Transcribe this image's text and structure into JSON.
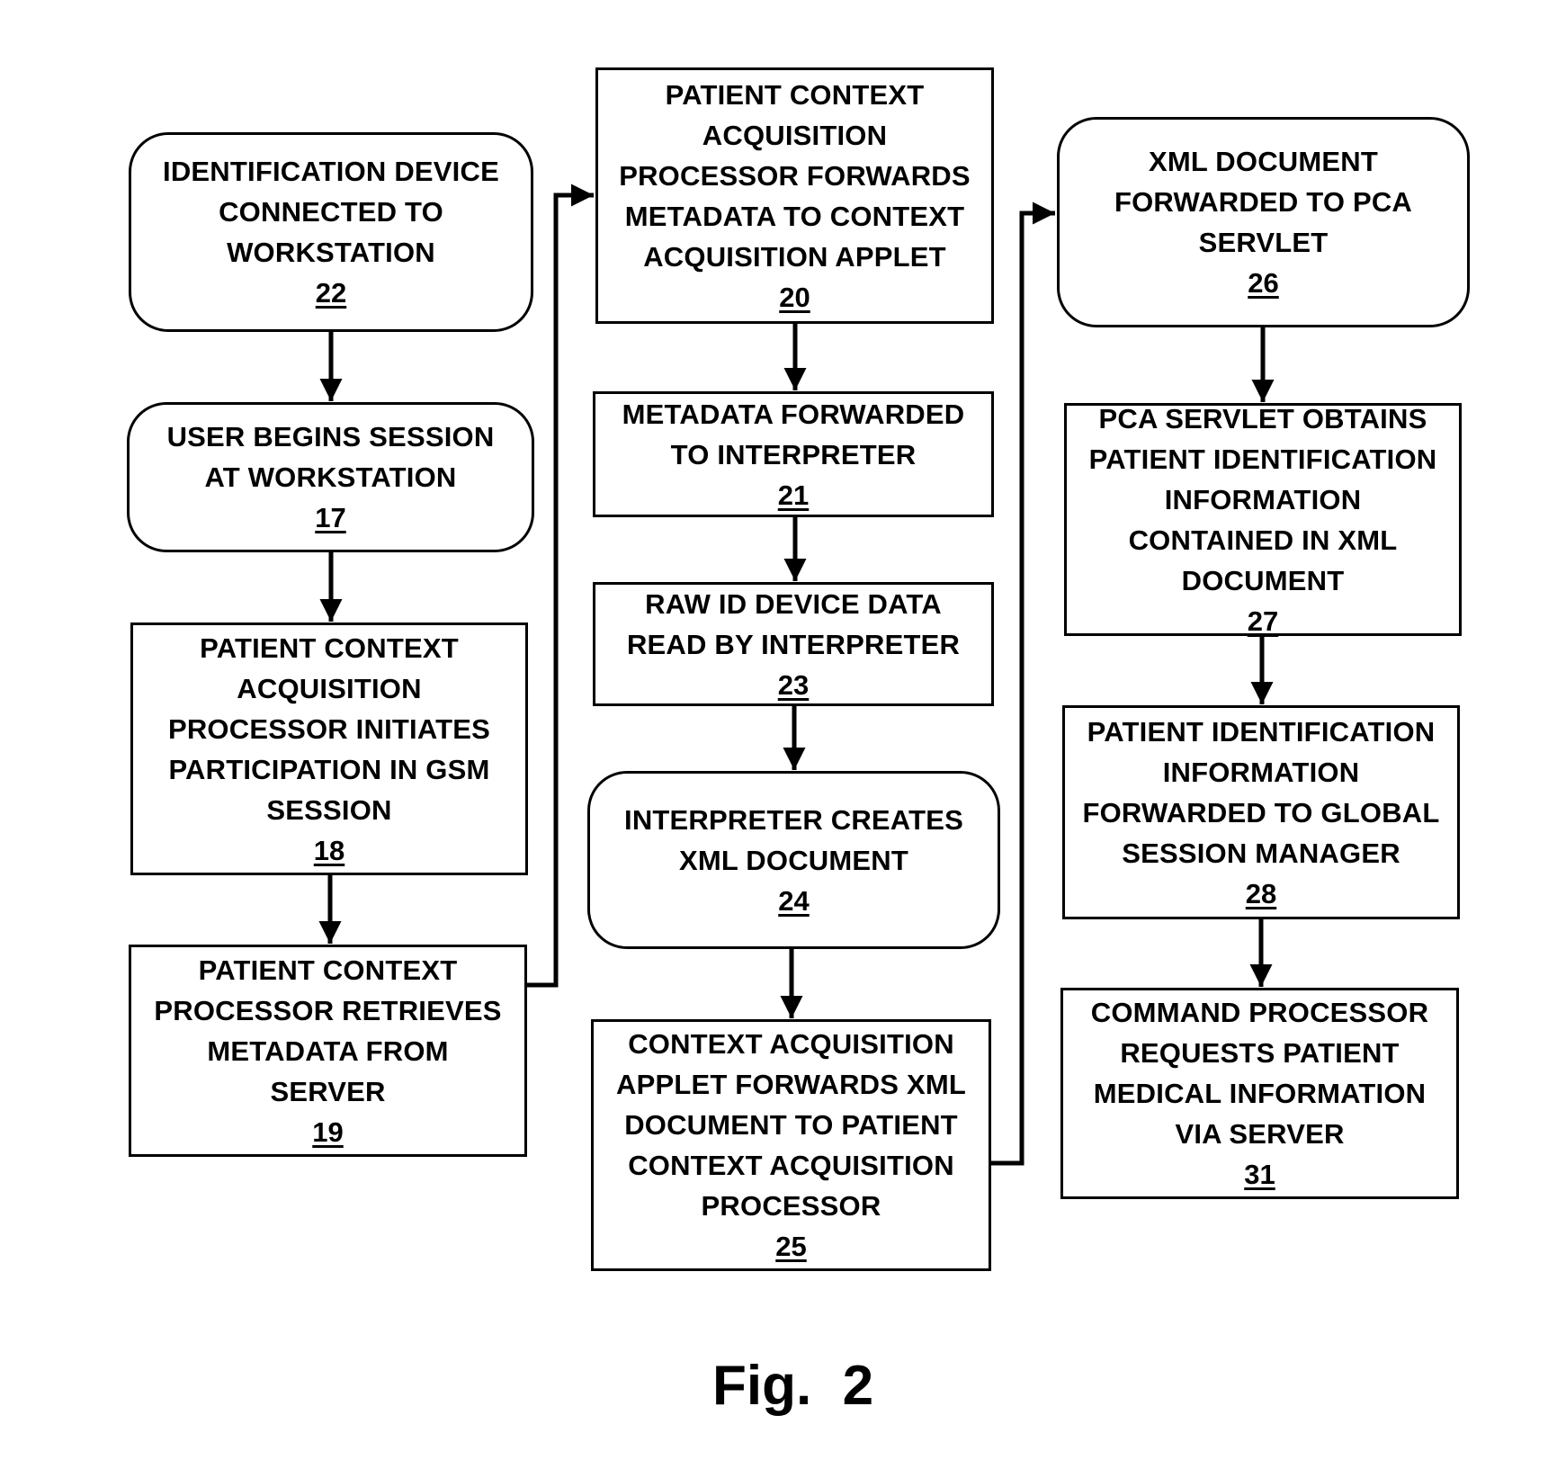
{
  "figure": {
    "label": "Fig.  2"
  },
  "steps": {
    "s22": {
      "lines": [
        "IDENTIFICATION DEVICE",
        "CONNECTED TO",
        "WORKSTATION"
      ],
      "ref": "22",
      "shape": "rounded"
    },
    "s17": {
      "lines": [
        "USER BEGINS SESSION",
        "AT WORKSTATION"
      ],
      "ref": "17",
      "shape": "rounded"
    },
    "s18": {
      "lines": [
        "PATIENT CONTEXT",
        "ACQUISITION",
        "PROCESSOR INITIATES",
        "PARTICIPATION IN GSM",
        "SESSION"
      ],
      "ref": "18",
      "shape": "rectangle"
    },
    "s19": {
      "lines": [
        "PATIENT CONTEXT",
        "PROCESSOR RETRIEVES",
        "METADATA FROM",
        "SERVER"
      ],
      "ref": "19",
      "shape": "rectangle"
    },
    "s20": {
      "lines": [
        "PATIENT CONTEXT",
        "ACQUISITION",
        "PROCESSOR FORWARDS",
        "METADATA TO CONTEXT",
        "ACQUISITION APPLET"
      ],
      "ref": "20",
      "shape": "rectangle"
    },
    "s21": {
      "lines": [
        "METADATA FORWARDED",
        "TO INTERPRETER"
      ],
      "ref": "21",
      "shape": "rectangle"
    },
    "s23": {
      "lines": [
        "RAW ID DEVICE DATA",
        "READ BY INTERPRETER"
      ],
      "ref": "23",
      "shape": "rectangle"
    },
    "s24": {
      "lines": [
        "INTERPRETER CREATES",
        "XML DOCUMENT"
      ],
      "ref": "24",
      "shape": "rounded"
    },
    "s25": {
      "lines": [
        "CONTEXT ACQUISITION",
        "APPLET FORWARDS XML",
        "DOCUMENT TO PATIENT",
        "CONTEXT ACQUISITION",
        "PROCESSOR"
      ],
      "ref": "25",
      "shape": "rectangle"
    },
    "s26": {
      "lines": [
        "XML DOCUMENT",
        "FORWARDED TO PCA",
        "SERVLET"
      ],
      "ref": "26",
      "shape": "rounded"
    },
    "s27": {
      "lines": [
        "PCA SERVLET OBTAINS",
        "PATIENT IDENTIFICATION",
        "INFORMATION",
        "CONTAINED IN XML",
        "DOCUMENT"
      ],
      "ref": "27",
      "shape": "rectangle"
    },
    "s28": {
      "lines": [
        "PATIENT IDENTIFICATION",
        "INFORMATION",
        "FORWARDED TO GLOBAL",
        "SESSION MANAGER"
      ],
      "ref": "28",
      "shape": "rectangle"
    },
    "s31": {
      "lines": [
        "COMMAND PROCESSOR",
        "REQUESTS PATIENT",
        "MEDICAL INFORMATION",
        "VIA SERVER"
      ],
      "ref": "31",
      "shape": "rectangle"
    }
  },
  "flow": [
    [
      "22",
      "17"
    ],
    [
      "17",
      "18"
    ],
    [
      "18",
      "19"
    ],
    [
      "19",
      "20"
    ],
    [
      "20",
      "21"
    ],
    [
      "21",
      "23"
    ],
    [
      "23",
      "24"
    ],
    [
      "24",
      "25"
    ],
    [
      "25",
      "26"
    ],
    [
      "26",
      "27"
    ],
    [
      "27",
      "28"
    ],
    [
      "28",
      "31"
    ]
  ]
}
